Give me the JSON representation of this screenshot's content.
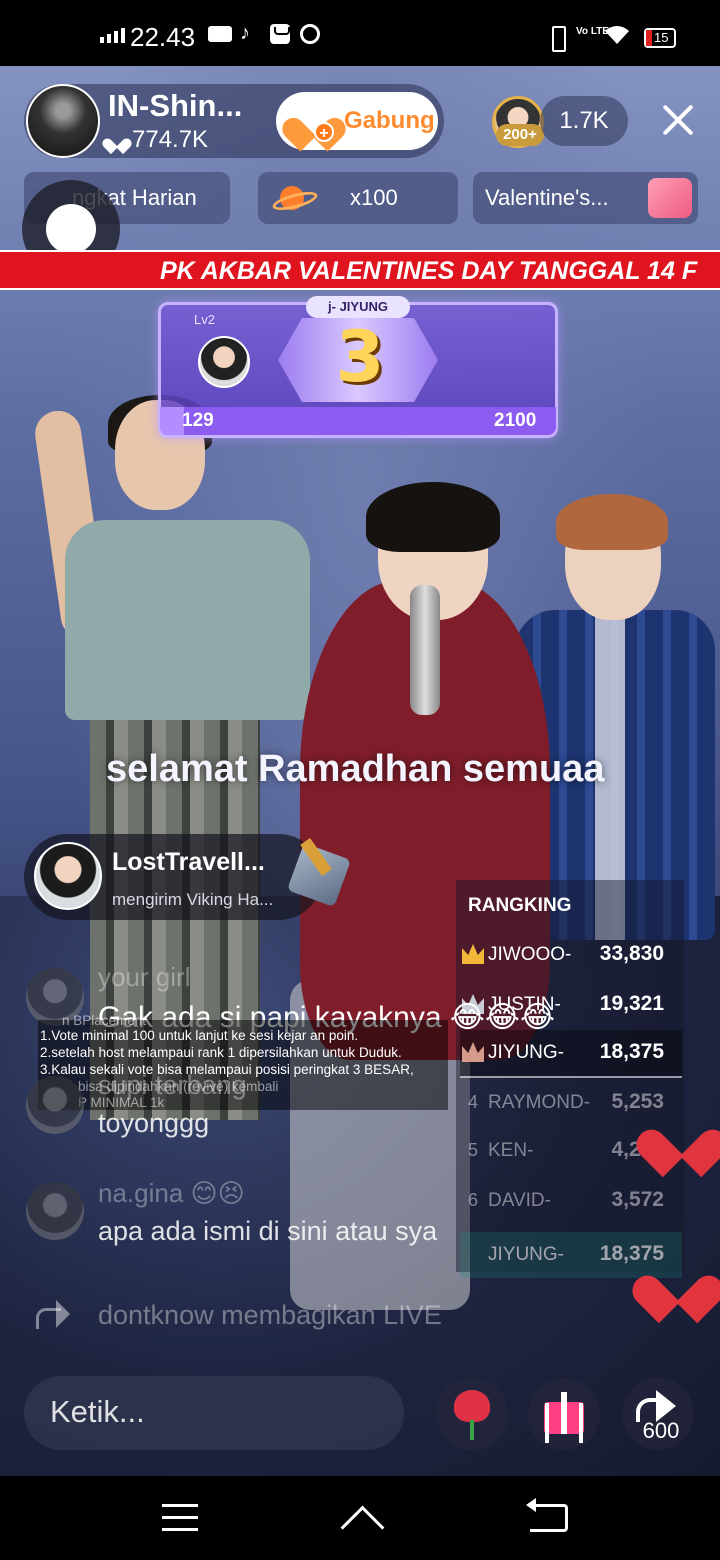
{
  "status_bar": {
    "time": "22.43",
    "battery": "15",
    "network": "Vo LTE"
  },
  "header": {
    "host_name": "IN-Shin...",
    "host_likes": "774.7K",
    "join_label": "Gabung",
    "viewer_badge": "200+",
    "viewer_count": "1.7K"
  },
  "chips": [
    {
      "label": "Peringkat Harian",
      "visible_label": "ngkat Harian"
    },
    {
      "label": "x100"
    },
    {
      "label": "Valentine's..."
    }
  ],
  "banner": {
    "text": "PK AKBAR VALENTINES DAY  TANGGAL 14 F"
  },
  "rank_card": {
    "level": "Lv2",
    "name": "j-   JIYUNG",
    "rank": "3",
    "current": "129",
    "target": "2100",
    "progress": 0.06
  },
  "caption": "selamat Ramadhan semuaa",
  "gift_toast": {
    "user": "LostTravell...",
    "message": "mengirim Viking Ha..."
  },
  "ranking": {
    "title": "RANGKING",
    "rows": [
      {
        "pos": "1",
        "name": "JIWOOO-",
        "score": "33,830"
      },
      {
        "pos": "2",
        "name": "JUSTIN-",
        "score": "19,321"
      },
      {
        "pos": "3",
        "name": "JIYUNG-",
        "score": "18,375"
      },
      {
        "pos": "4",
        "name": "RAYMOND-",
        "score": "5,253"
      },
      {
        "pos": "5",
        "name": "KEN-",
        "score": "4,284"
      },
      {
        "pos": "6",
        "name": "DAVID-",
        "score": "3,572"
      }
    ],
    "self_row": {
      "name": "JIYUNG-",
      "score": "18,375"
    }
  },
  "rules": [
    "n BPlacement",
    "1.Vote minimal 100 untuk lanjut ke sesi kejar an poin.",
    "2.setelah host melampaui rank 1 dipersilahkan untuk Duduk.",
    "3.Kalau sekali vote bisa melampaui posisi  peringkat 3 BESAR,",
    "bisa dipindahkan (revive) kembali",
    "P MINIMAL 1k"
  ],
  "chat": [
    {
      "user": "your girl",
      "message": "Gak ada si papi kayaknya 😂😂😂"
    },
    {
      "user": "",
      "message": "supi terbang"
    },
    {
      "user": "",
      "message": "toyonggg"
    },
    {
      "user": "na.gina 😊😣",
      "message": "apa ada ismi di sini atau sya"
    },
    {
      "user": "dontknow",
      "message": "dontknow membagikan LIVE"
    }
  ],
  "bottom_bar": {
    "input_placeholder": "Ketik...",
    "share_count": "600"
  }
}
